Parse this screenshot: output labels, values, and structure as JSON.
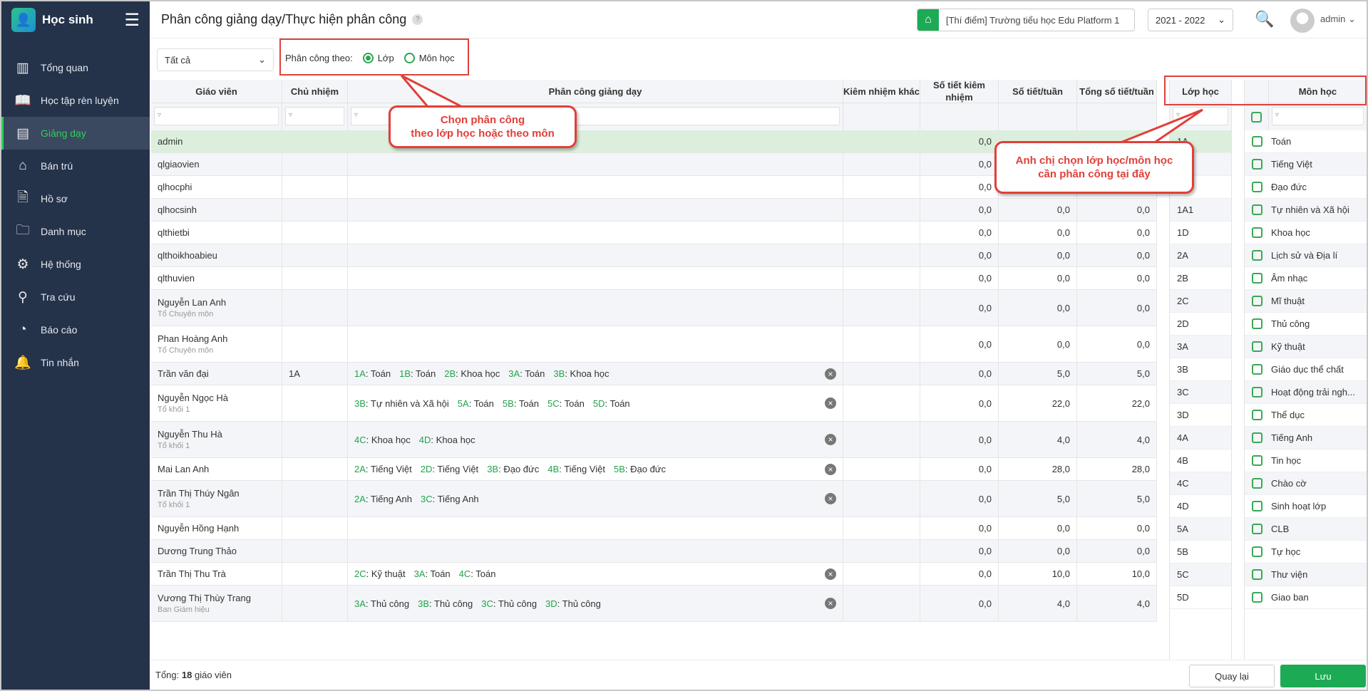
{
  "app": {
    "name": "Học sinh"
  },
  "sidebar": {
    "items": [
      {
        "label": "Tổng quan",
        "icon": "chart-bars-icon"
      },
      {
        "label": "Học tập rèn luyện",
        "icon": "book-icon"
      },
      {
        "label": "Giảng dạy",
        "icon": "board-icon",
        "active": true
      },
      {
        "label": "Bán trú",
        "icon": "home-icon"
      },
      {
        "label": "Hồ sơ",
        "icon": "document-icon"
      },
      {
        "label": "Danh mục",
        "icon": "folder-icon"
      },
      {
        "label": "Hệ thống",
        "icon": "gear-icon"
      },
      {
        "label": "Tra cứu",
        "icon": "search-icon"
      },
      {
        "label": "Báo cáo",
        "icon": "pie-chart-icon"
      },
      {
        "label": "Tin nhắn",
        "icon": "bell-icon"
      }
    ]
  },
  "header": {
    "title": "Phân công giảng dạy/Thực hiện phân công",
    "help": "?",
    "school": "[Thí điểm] Trường tiểu học Edu Platform 1",
    "year": "2021 - 2022",
    "user": "admin"
  },
  "toolbar": {
    "filter": "Tất cả",
    "assign_by_label": "Phân công theo:",
    "option_class": "Lớp",
    "option_subject": "Môn học"
  },
  "table": {
    "columns": [
      "Giáo viên",
      "Chủ nhiệm",
      "Phân công giảng dạy",
      "Kiêm nhiệm khác",
      "Số tiết kiêm nhiệm",
      "Số tiết/tuần",
      "Tổng số tiết/tuần"
    ],
    "rows": [
      {
        "name": "admin",
        "stkn": "0,0",
        "stt": "",
        "tong": "",
        "hl": true
      },
      {
        "name": "qlgiaovien",
        "stkn": "0,0",
        "stt": "",
        "tong": ""
      },
      {
        "name": "qlhocphi",
        "stkn": "0,0",
        "stt": "",
        "tong": ""
      },
      {
        "name": "qlhocsinh",
        "stkn": "0,0",
        "stt": "0,0",
        "tong": "0,0"
      },
      {
        "name": "qlthietbi",
        "stkn": "0,0",
        "stt": "0,0",
        "tong": "0,0"
      },
      {
        "name": "qlthoikhoabieu",
        "stkn": "0,0",
        "stt": "0,0",
        "tong": "0,0"
      },
      {
        "name": "qlthuvien",
        "stkn": "0,0",
        "stt": "0,0",
        "tong": "0,0"
      },
      {
        "name": "Nguyễn Lan Anh",
        "sub": "Tổ Chuyên môn",
        "stkn": "0,0",
        "stt": "0,0",
        "tong": "0,0"
      },
      {
        "name": "Phan Hoàng Anh",
        "sub": "Tổ Chuyên môn",
        "stkn": "0,0",
        "stt": "0,0",
        "tong": "0,0"
      },
      {
        "name": "Trần văn đại",
        "cn": "1A",
        "asg": [
          [
            "1A",
            "Toán"
          ],
          [
            "1B",
            "Toán"
          ],
          [
            "2B",
            "Khoa học"
          ],
          [
            "3A",
            "Toán"
          ],
          [
            "3B",
            "Khoa học"
          ]
        ],
        "stkn": "0,0",
        "stt": "5,0",
        "tong": "5,0"
      },
      {
        "name": "Nguyễn Ngọc Hà",
        "sub": "Tổ khối 1",
        "asg": [
          [
            "3B",
            "Tự nhiên và Xã hội"
          ],
          [
            "5A",
            "Toán"
          ],
          [
            "5B",
            "Toán"
          ],
          [
            "5C",
            "Toán"
          ],
          [
            "5D",
            "Toán"
          ]
        ],
        "stkn": "0,0",
        "stt": "22,0",
        "tong": "22,0"
      },
      {
        "name": "Nguyễn Thu Hà",
        "sub": "Tổ khối 1",
        "asg": [
          [
            "4C",
            "Khoa học"
          ],
          [
            "4D",
            "Khoa học"
          ]
        ],
        "stkn": "0,0",
        "stt": "4,0",
        "tong": "4,0"
      },
      {
        "name": "Mai Lan Anh",
        "asg": [
          [
            "2A",
            "Tiếng Việt"
          ],
          [
            "2D",
            "Tiếng Việt"
          ],
          [
            "3B",
            "Đạo đức"
          ],
          [
            "4B",
            "Tiếng Việt"
          ],
          [
            "5B",
            "Đạo đức"
          ]
        ],
        "stkn": "0,0",
        "stt": "28,0",
        "tong": "28,0"
      },
      {
        "name": "Trần Thị Thúy Ngân",
        "sub": "Tổ khối 1",
        "asg": [
          [
            "2A",
            "Tiếng Anh"
          ],
          [
            "3C",
            "Tiếng Anh"
          ]
        ],
        "stkn": "0,0",
        "stt": "5,0",
        "tong": "5,0"
      },
      {
        "name": "Nguyễn Hồng Hạnh",
        "stkn": "0,0",
        "stt": "0,0",
        "tong": "0,0"
      },
      {
        "name": "Dương Trung Thảo",
        "stkn": "0,0",
        "stt": "0,0",
        "tong": "0,0"
      },
      {
        "name": "Trần Thị Thu Trà",
        "asg": [
          [
            "2C",
            "Kỹ thuật"
          ],
          [
            "3A",
            "Toán"
          ],
          [
            "4C",
            "Toán"
          ]
        ],
        "stkn": "0,0",
        "stt": "10,0",
        "tong": "10,0"
      },
      {
        "name": "Vương Thị Thùy Trang",
        "sub": "Ban Giám hiệu",
        "asg": [
          [
            "3A",
            "Thủ công"
          ],
          [
            "3B",
            "Thủ công"
          ],
          [
            "3C",
            "Thủ công"
          ],
          [
            "3D",
            "Thủ công"
          ]
        ],
        "stkn": "0,0",
        "stt": "4,0",
        "tong": "4,0"
      }
    ]
  },
  "classes": {
    "title": "Lớp học",
    "items": [
      "1A",
      "",
      "",
      "1A1",
      "1D",
      "2A",
      "2B",
      "2C",
      "2D",
      "3A",
      "3B",
      "3C",
      "3D",
      "4A",
      "4B",
      "4C",
      "4D",
      "5A",
      "5B",
      "5C",
      "5D"
    ]
  },
  "subjects": {
    "title": "Môn học",
    "items": [
      "Toán",
      "Tiếng Việt",
      "Đạo đức",
      "Tự nhiên và Xã hội",
      "Khoa học",
      "Lịch sử và Địa lí",
      "Âm nhạc",
      "Mĩ thuật",
      "Thủ công",
      "Kỹ thuật",
      "Giáo dục thể chất",
      "Hoạt động trải ngh...",
      "Thể dục",
      "Tiếng Anh",
      "Tin học",
      "Chào cờ",
      "Sinh hoạt lớp",
      "CLB",
      "Tự học",
      "Thư viện",
      "Giao ban"
    ]
  },
  "footer": {
    "total_label": "Tổng:",
    "total_count": "18",
    "total_unit": "giáo viên",
    "back": "Quay lại",
    "save": "Lưu"
  },
  "callouts": {
    "one_line1": "Chọn phân công",
    "one_line2": "theo lớp học hoặc theo môn",
    "two_line1": "Anh chị chọn lớp học/môn học",
    "two_line2": "cần phân công tại đây"
  },
  "colors": {
    "accent": "#2ea44f",
    "sidebar": "#24324a",
    "annotation": "#e0403a"
  }
}
